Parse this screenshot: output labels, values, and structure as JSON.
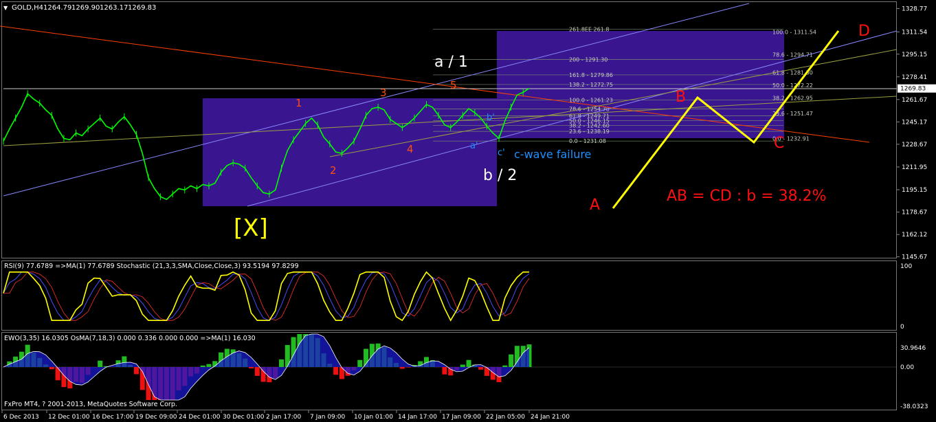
{
  "chart_data": {
    "type": "line",
    "symbol_header": "GOLD,H4",
    "ohlc_readout": [
      "1264.79",
      "1269.90",
      "1263.17",
      "1269.83"
    ],
    "current_price_label": "1269.83",
    "price_axis": {
      "ticks": [
        "1328.77",
        "1311.54",
        "1295.15",
        "1278.41",
        "1261.67",
        "1245.17",
        "1228.67",
        "1211.95",
        "1195.15",
        "1178.67",
        "1162.12",
        "1145.67"
      ],
      "range": [
        1138,
        1333
      ]
    },
    "time_axis": {
      "ticks": [
        "6 Dec 2013",
        "12 Dec 01:00",
        "16 Dec 17:00",
        "19 Dec 09:00",
        "24 Dec 01:00",
        "30 Dec 01:00",
        "2 Jan 17:00",
        "7 Jan 09:00",
        "10 Jan 01:00",
        "14 Jan 17:00",
        "17 Jan 09:00",
        "22 Jan 05:00",
        "24 Jan 21:00"
      ]
    },
    "price_series": [
      1231,
      1240,
      1248,
      1256,
      1266,
      1262,
      1259,
      1254,
      1250,
      1240,
      1233,
      1232,
      1237,
      1235,
      1240,
      1244,
      1248,
      1242,
      1240,
      1245,
      1249,
      1243,
      1236,
      1222,
      1204,
      1196,
      1190,
      1188,
      1192,
      1196,
      1195,
      1198,
      1196,
      1199,
      1198,
      1200,
      1208,
      1213,
      1215,
      1214,
      1211,
      1204,
      1198,
      1193,
      1192,
      1195,
      1211,
      1224,
      1232,
      1238,
      1244,
      1248,
      1243,
      1234,
      1229,
      1223,
      1222,
      1226,
      1231,
      1240,
      1250,
      1255,
      1256,
      1254,
      1247,
      1244,
      1241,
      1244,
      1248,
      1253,
      1258,
      1256,
      1250,
      1243,
      1241,
      1245,
      1250,
      1255,
      1252,
      1248,
      1242,
      1237,
      1233,
      1246,
      1256,
      1265,
      1267,
      1270
    ],
    "rsi_header": "RSI(9) 77.6789  =>MA(1) 77.6789  Stochastic (21,3,3,SMA,Close,Close,3) 93.5194 97.8299",
    "rsi_axis": [
      "100",
      "0"
    ],
    "ewo_header": "EWO(3,35) 16.0305  OsMA(7,18,3) 0.000 0.336 0.000 0.000  =>MA(1) 16.030",
    "ewo_axis": [
      "30.9646",
      "0.00",
      "-38.0323"
    ],
    "copyright": "FxPro MT4, ? 2001-2013, MetaQuotes Software Corp.",
    "fib_levels": [
      {
        "label": "261.8EE 261.8",
        "price": 1313.5
      },
      {
        "label": "200 - 1291.30",
        "price": 1291.3
      },
      {
        "label": "161.8 - 1279.86",
        "price": 1279.86
      },
      {
        "label": "138.2 - 1272.75",
        "price": 1272.75
      },
      {
        "label": "100.0 - 1261.23",
        "price": 1261.23
      },
      {
        "label": "78.6 - 1254.78",
        "price": 1254.78
      },
      {
        "label": "61.8 - 1249.71",
        "price": 1249.71
      },
      {
        "label": "50.0 - 1246.15",
        "price": 1246.15
      },
      {
        "label": "38.2 - 1242.60",
        "price": 1242.6
      },
      {
        "label": "23.6 - 1238.19",
        "price": 1238.19
      },
      {
        "label": "0.0 - 1231.08",
        "price": 1231.08
      }
    ],
    "fib_levels_right": [
      {
        "label": "100.0 - 1311.54",
        "price": 1311.54
      },
      {
        "label": "78.6 - 1294.71",
        "price": 1294.71
      },
      {
        "label": "61.8 - 1281.50",
        "price": 1281.5
      },
      {
        "label": "50.0 - 1272.22",
        "price": 1272.22
      },
      {
        "label": "38.2 - 1262.95",
        "price": 1262.95
      },
      {
        "label": "23.6 - 1251.47",
        "price": 1251.47
      },
      {
        "label": "0.0 - 1232.91",
        "price": 1232.91
      }
    ],
    "wave_labels": [
      {
        "text": "1",
        "color": "#ff5010"
      },
      {
        "text": "2",
        "color": "#ff5010"
      },
      {
        "text": "3",
        "color": "#ff5010"
      },
      {
        "text": "4",
        "color": "#ff5010"
      },
      {
        "text": "5",
        "color": "#ff5010"
      },
      {
        "text": "a'",
        "color": "#1e90ff"
      },
      {
        "text": "b'",
        "color": "#1e90ff"
      },
      {
        "text": "c'",
        "color": "#1e90ff"
      },
      {
        "text": "c-wave failure",
        "color": "#1e90ff"
      },
      {
        "text": "a / 1",
        "color": "#ffffff"
      },
      {
        "text": "b / 2",
        "color": "#ffffff"
      },
      {
        "text": "[X]",
        "color": "#ffff00"
      },
      {
        "text": "A",
        "color": "#ff1010"
      },
      {
        "text": "B",
        "color": "#ff1010"
      },
      {
        "text": "C",
        "color": "#ff1010"
      },
      {
        "text": "D",
        "color": "#ff1010"
      },
      {
        "text": "AB = CD : b = 38.2%",
        "color": "#ff1010"
      }
    ],
    "colors": {
      "background": "#000000",
      "price_line": "#00ff00",
      "box_fill": "#3a1590",
      "projection": "#ffff00",
      "rsi": "#ffff00",
      "stoch_main": "#4a4aff",
      "stoch_signal": "#ff3030",
      "ewo_positive": "#22bb22",
      "ewo_negative": "#ee1111",
      "osma": "#1a1acc",
      "trendline_blue": "#8888ff",
      "trendline_red": "#ff4000",
      "trendline_olive": "#9aa040"
    }
  }
}
